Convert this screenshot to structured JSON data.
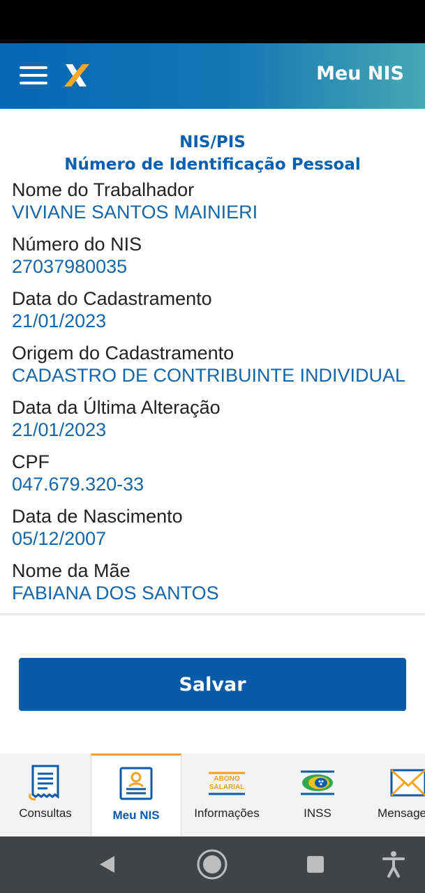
{
  "app_bar": {
    "title": "Meu NIS"
  },
  "header": {
    "line1": "NIS/PIS",
    "line2": "Número de Identificação Pessoal"
  },
  "fields": [
    {
      "label": "Nome do Trabalhador",
      "value": "VIVIANE SANTOS MAINIERI"
    },
    {
      "label": "Número do NIS",
      "value": "27037980035"
    },
    {
      "label": "Data do Cadastramento",
      "value": "21/01/2023"
    },
    {
      "label": "Origem do Cadastramento",
      "value": "CADASTRO DE CONTRIBUINTE INDIVIDUAL"
    },
    {
      "label": "Data da Última Alteração",
      "value": "21/01/2023"
    },
    {
      "label": "CPF",
      "value": "047.679.320-33"
    },
    {
      "label": "Data de Nascimento",
      "value": "05/12/2007"
    },
    {
      "label": "Nome da Mãe",
      "value": "FABIANA DOS SANTOS"
    }
  ],
  "save_button": {
    "label": "Salvar"
  },
  "bottom_nav": {
    "items": [
      {
        "label": "Consultas",
        "icon": "receipt-icon",
        "active": false
      },
      {
        "label": "Meu NIS",
        "icon": "id-card-icon",
        "active": true
      },
      {
        "label": "Informações",
        "icon": "abono-salarial-icon",
        "icon_text_1": "ABONO",
        "icon_text_2": "SALARIAL",
        "active": false
      },
      {
        "label": "INSS",
        "icon": "inss-logo-icon",
        "active": false
      },
      {
        "label": "Mensagens",
        "icon": "envelope-icon",
        "active": false
      }
    ]
  },
  "colors": {
    "primary": "#0a5aaa",
    "value_text": "#1565a8",
    "accent": "#f2a31b",
    "app_bar_gradient_start": "#0567b5",
    "app_bar_gradient_end": "#46a8b3"
  }
}
